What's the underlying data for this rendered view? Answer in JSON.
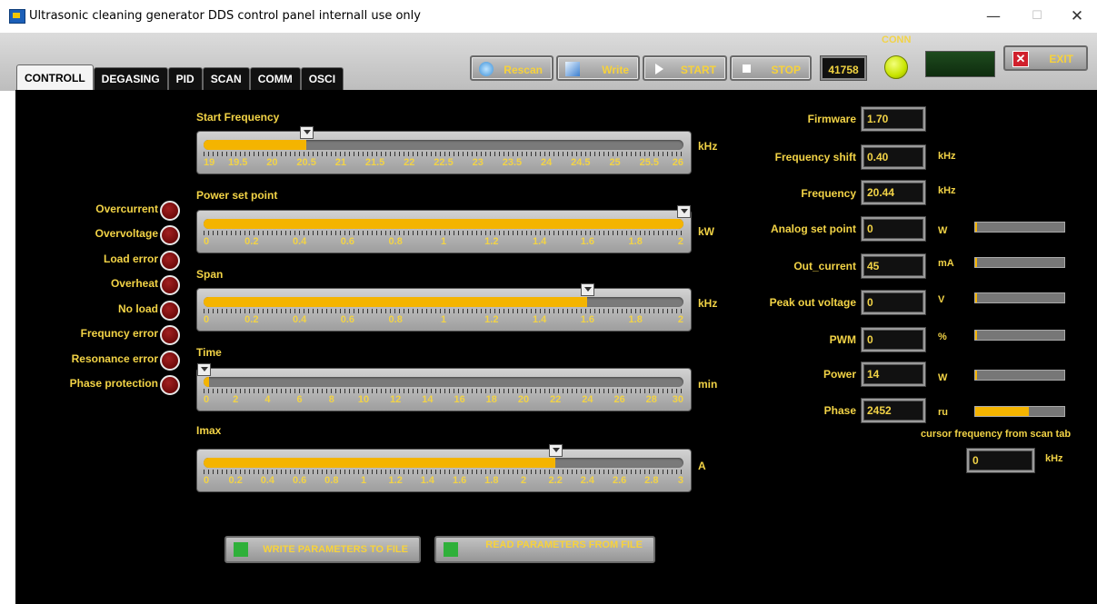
{
  "window": {
    "title": "Ultrasonic cleaning generator DDS control panel internall use only",
    "minimize": "—",
    "maximize": "☐",
    "close": "✕"
  },
  "tabs": [
    "CONTROLL",
    "DEGASING",
    "PID",
    "SCAN",
    "COMM",
    "OSCI"
  ],
  "toolbar": {
    "rescan": "Rescan",
    "write": "Write",
    "start": "START",
    "stop": "STOP",
    "counter": "41758",
    "conn": "CONN",
    "exit": "EXIT"
  },
  "sliders": {
    "start_frequency": {
      "title": "Start Frequency",
      "unit": "kHz",
      "value": 20.5,
      "min": 19,
      "max": 26,
      "ticks": [
        "19",
        "19.5",
        "20",
        "20.5",
        "21",
        "21.5",
        "22",
        "22.5",
        "23",
        "23.5",
        "24",
        "24.5",
        "25",
        "25.5",
        "26"
      ]
    },
    "power_set_point": {
      "title": "Power set point",
      "unit": "kW",
      "value": 2,
      "min": 0,
      "max": 2,
      "ticks": [
        "0",
        "0.2",
        "0.4",
        "0.6",
        "0.8",
        "1",
        "1.2",
        "1.4",
        "1.6",
        "1.8",
        "2"
      ]
    },
    "span": {
      "title": "Span",
      "unit": "kHz",
      "value": 1.6,
      "min": 0,
      "max": 2,
      "ticks": [
        "0",
        "0.2",
        "0.4",
        "0.6",
        "0.8",
        "1",
        "1.2",
        "1.4",
        "1.6",
        "1.8",
        "2"
      ]
    },
    "time": {
      "title": "Time",
      "unit": "min",
      "value": 0,
      "min": 0,
      "max": 30,
      "ticks": [
        "0",
        "2",
        "4",
        "6",
        "8",
        "10",
        "12",
        "14",
        "16",
        "18",
        "20",
        "22",
        "24",
        "26",
        "28",
        "30"
      ]
    },
    "imax": {
      "title": "Imax",
      "unit": "A",
      "value": 2.2,
      "min": 0,
      "max": 3,
      "ticks": [
        "0",
        "0.2",
        "0.4",
        "0.6",
        "0.8",
        "1",
        "1.2",
        "1.4",
        "1.6",
        "1.8",
        "2",
        "2.2",
        "2.4",
        "2.6",
        "2.8",
        "3"
      ]
    }
  },
  "alarms": [
    "Overcurrent",
    "Overvoltage",
    "Load error",
    "Overheat",
    "No load",
    "Frequncy error",
    "Resonance error",
    "Phase protection"
  ],
  "readouts": {
    "firmware": {
      "label": "Firmware",
      "value": "1.70",
      "unit": ""
    },
    "frequency_shift": {
      "label": "Frequency shift",
      "value": "0.40",
      "unit": "kHz"
    },
    "frequency": {
      "label": "Frequency",
      "value": "20.44",
      "unit": "kHz"
    },
    "analog_set_point": {
      "label": "Analog set point",
      "value": "0",
      "unit": "W",
      "level": 0
    },
    "out_current": {
      "label": "Out_current",
      "value": "45",
      "unit": "mA",
      "level": 0.02
    },
    "peak_out_voltage": {
      "label": "Peak out voltage",
      "value": "0",
      "unit": "V",
      "level": 0.01
    },
    "pwm": {
      "label": "PWM",
      "value": "0",
      "unit": "%",
      "level": 0.01
    },
    "power": {
      "label": "Power",
      "value": "14",
      "unit": "W",
      "level": 0.01
    },
    "phase": {
      "label": "Phase",
      "value": "2452",
      "unit": "ru",
      "level": 0.6
    }
  },
  "cursor": {
    "label": "cursor frequency  from  scan tab",
    "value": "0",
    "unit": "kHz"
  },
  "buttons": {
    "write_file": "WRITE PARAMETERS TO FILE",
    "read_file": "READ PARAMETERS FROM FILE"
  }
}
